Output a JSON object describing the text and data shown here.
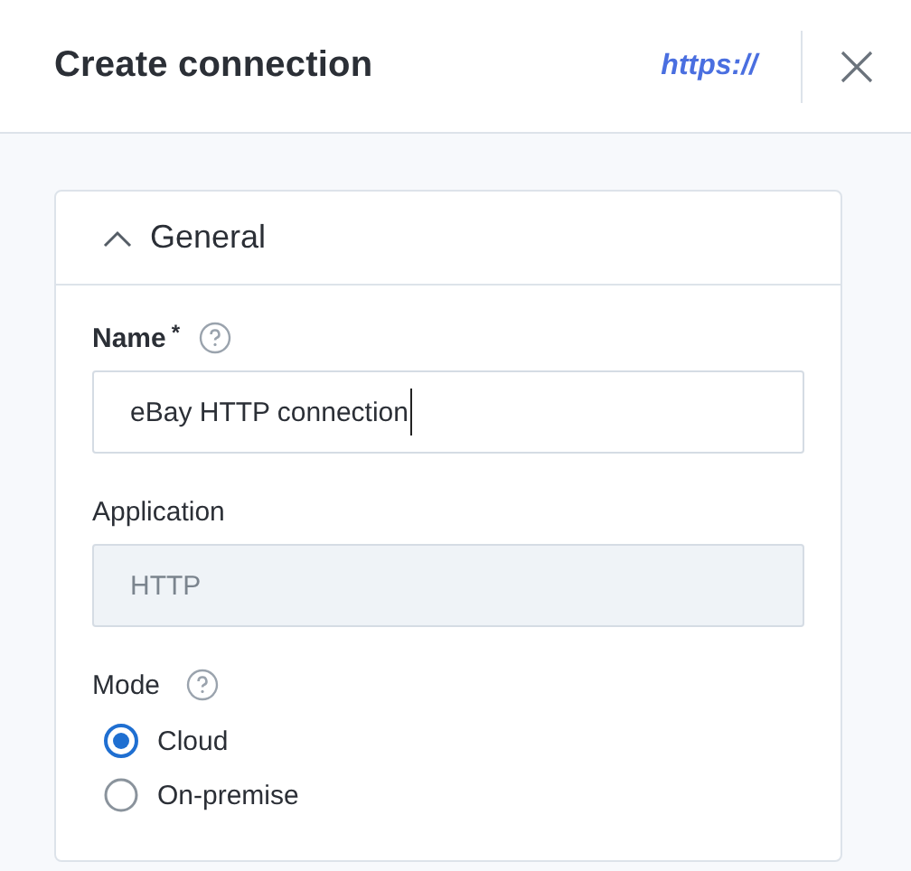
{
  "header": {
    "title": "Create connection",
    "badge": "https://"
  },
  "section": {
    "title": "General",
    "expanded": true,
    "fields": [
      {
        "kind": "text",
        "label": "Name",
        "required_mark": "*",
        "help": true,
        "value": "eBay HTTP connection",
        "disabled": false,
        "focused": true
      },
      {
        "kind": "text",
        "label": "Application",
        "help": false,
        "value": "HTTP",
        "disabled": true,
        "focused": false
      },
      {
        "kind": "radio",
        "label": "Mode",
        "help": true,
        "options": [
          {
            "label": "Cloud",
            "selected": true
          },
          {
            "label": "On-premise",
            "selected": false
          }
        ]
      }
    ]
  }
}
